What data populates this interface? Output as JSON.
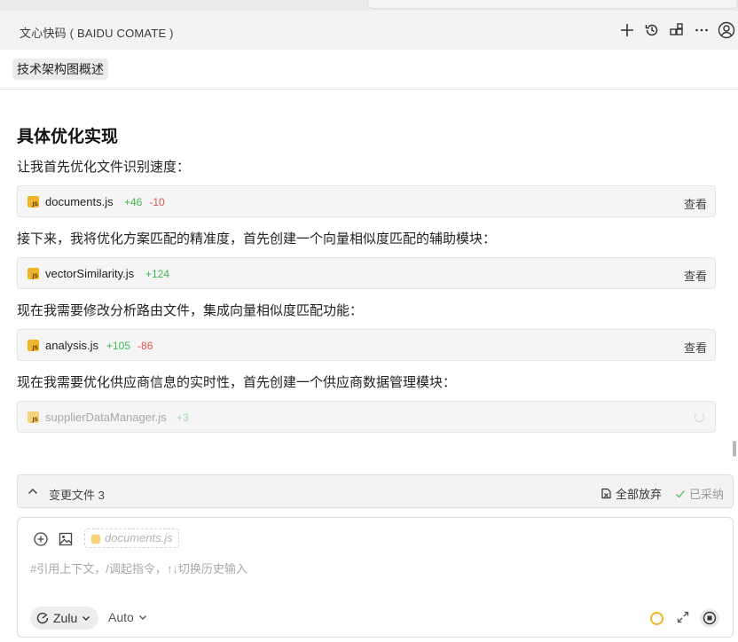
{
  "title_bar": {
    "title": "文心快码 ( BAIDU COMATE )",
    "icons": [
      "plus-icon",
      "history-icon",
      "layout-icon",
      "more-icon",
      "account-icon"
    ]
  },
  "chip": {
    "label": "技术架构图概述"
  },
  "section": {
    "heading": "具体优化实现"
  },
  "paragraphs": [
    "让我首先优化文件识别速度：",
    "接下来，我将优化方案匹配的精准度，首先创建一个向量相似度匹配的辅助模块：",
    "现在我需要修改分析路由文件，集成向量相似度匹配功能：",
    "现在我需要优化供应商信息的实时性，首先创建一个供应商数据管理模块："
  ],
  "files": [
    {
      "name": "documents.js",
      "added": "+46",
      "removed": "-10",
      "action": "查看"
    },
    {
      "name": "vectorSimilarity.js",
      "added": "+124",
      "removed": "",
      "action": "查看"
    },
    {
      "name": "analysis.js",
      "added": "+105",
      "removed": "-86",
      "action": "查看"
    },
    {
      "name": "supplierDataManager.js",
      "added": "+3",
      "removed": "",
      "action": ""
    }
  ],
  "changes_bar": {
    "label": "变更文件 3",
    "discard_all": "全部放弃",
    "accepted": "已采纳"
  },
  "input": {
    "context_chip": "documents.js",
    "placeholder": "#引用上下文，/调起指令，↑↓切换历史输入",
    "model": "Zulu",
    "mode": "Auto"
  },
  "colors": {
    "added": "#3fb950",
    "removed": "#e5534b",
    "js_icon": "#f0b42a"
  }
}
